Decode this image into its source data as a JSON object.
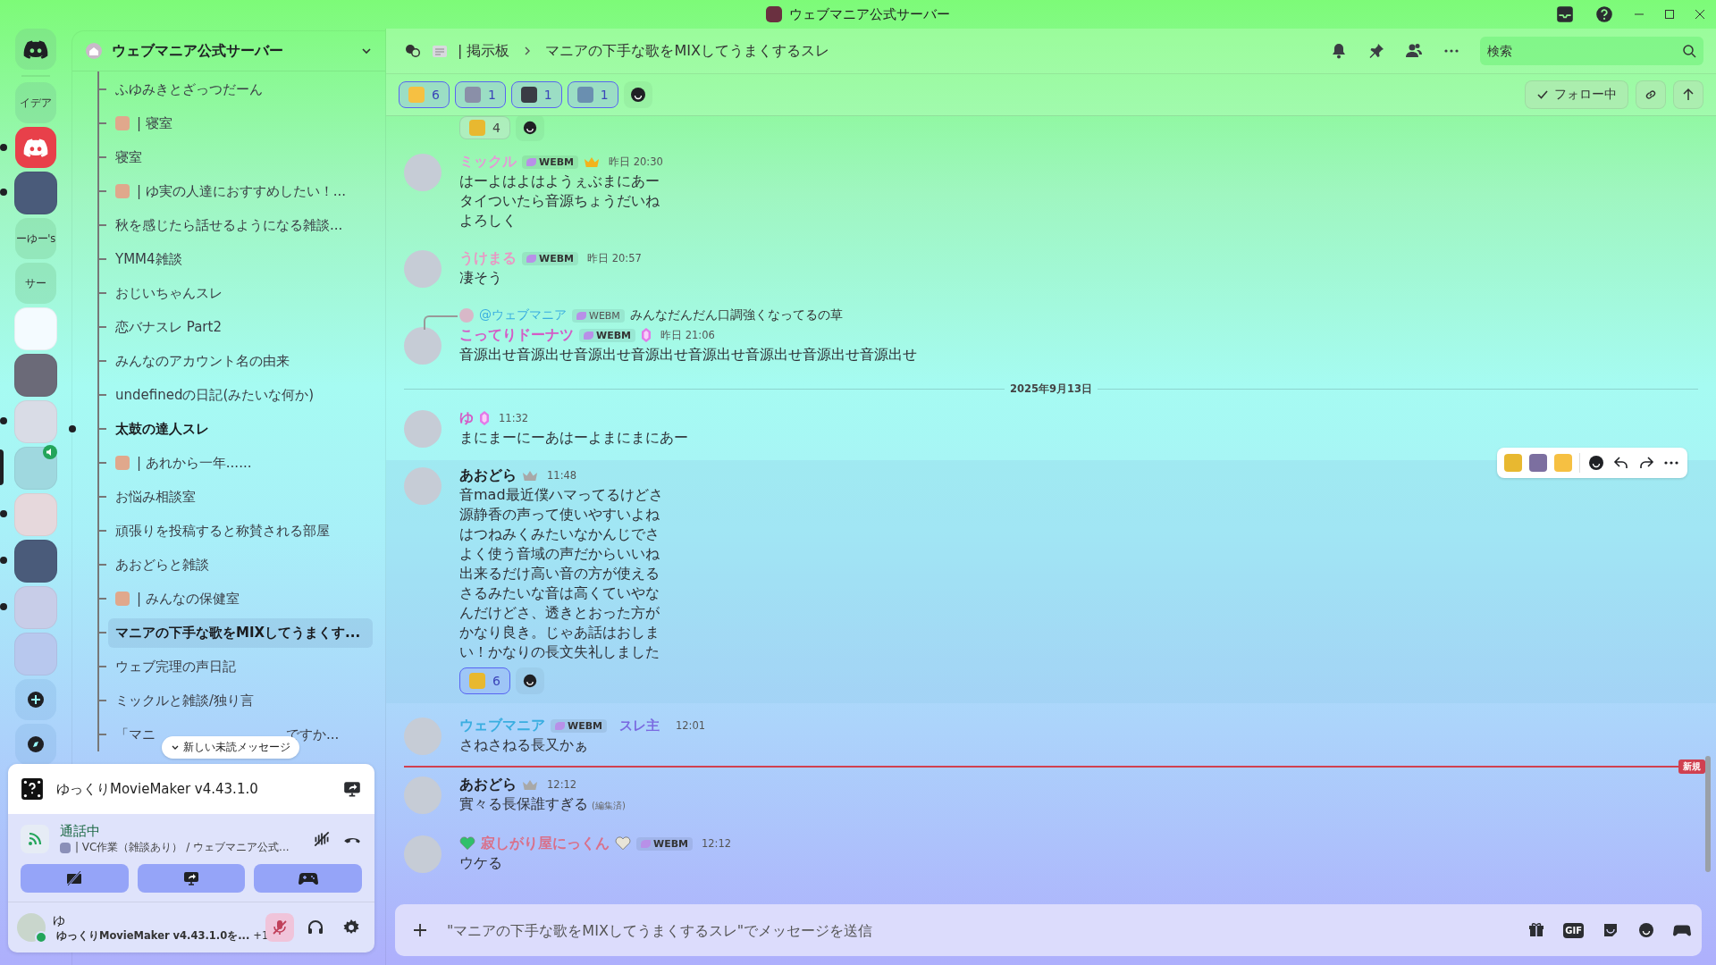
{
  "window": {
    "title": "ウェブマニア公式サーバー"
  },
  "servers": [
    {
      "kind": "home",
      "unread": false,
      "selected": false
    },
    {
      "kind": "text",
      "label": "イデア",
      "unread": false,
      "selected": false
    },
    {
      "kind": "discord",
      "unread": true,
      "selected": false
    },
    {
      "kind": "image",
      "unread": true,
      "selected": false
    },
    {
      "kind": "text",
      "label": "ーゆー's",
      "unread": false,
      "selected": false
    },
    {
      "kind": "text",
      "label": "サー",
      "unread": false,
      "selected": false
    },
    {
      "kind": "image",
      "unread": false,
      "selected": false
    },
    {
      "kind": "image",
      "unread": false,
      "selected": false
    },
    {
      "kind": "image",
      "unread": true,
      "selected": false
    },
    {
      "kind": "image",
      "unread": false,
      "selected": true,
      "speaking": true
    },
    {
      "kind": "image",
      "unread": true,
      "selected": false
    },
    {
      "kind": "image",
      "unread": true,
      "selected": false
    },
    {
      "kind": "image",
      "unread": true,
      "selected": false
    },
    {
      "kind": "image",
      "unread": false,
      "selected": false
    },
    {
      "kind": "add",
      "unread": false,
      "selected": false
    },
    {
      "kind": "discover",
      "unread": false,
      "selected": false
    }
  ],
  "server_header": {
    "name": "ウェブマニア公式サーバー"
  },
  "channels": [
    {
      "name": "ふゆみきとざっつだーん",
      "emoji": false,
      "unread": false,
      "selected": false
    },
    {
      "name": "| 寝室",
      "emoji": true,
      "unread": false,
      "selected": false
    },
    {
      "name": "寝室",
      "emoji": false,
      "unread": false,
      "selected": false
    },
    {
      "name": "| ゆ実の人達におすすめしたい！...",
      "emoji": true,
      "unread": false,
      "selected": false
    },
    {
      "name": "秋を感じたら話せるようになる雑談...",
      "emoji": false,
      "unread": false,
      "selected": false
    },
    {
      "name": "YMM4雑談",
      "emoji": false,
      "unread": false,
      "selected": false
    },
    {
      "name": "おじいちゃんスレ",
      "emoji": false,
      "unread": false,
      "selected": false
    },
    {
      "name": "恋バナスレ Part2",
      "emoji": false,
      "unread": false,
      "selected": false
    },
    {
      "name": "みんなのアカウント名の由来",
      "emoji": false,
      "unread": false,
      "selected": false
    },
    {
      "name": "undefinedの日記(みたいな何か)",
      "emoji": false,
      "unread": false,
      "selected": false
    },
    {
      "name": "太鼓の達人スレ",
      "emoji": false,
      "unread": true,
      "selected": false
    },
    {
      "name": "| あれから一年......",
      "emoji": true,
      "unread": false,
      "selected": false
    },
    {
      "name": "お悩み相談室",
      "emoji": false,
      "unread": false,
      "selected": false
    },
    {
      "name": "頑張りを投稿すると称賛される部屋",
      "emoji": false,
      "unread": false,
      "selected": false
    },
    {
      "name": "あおどらと雑談",
      "emoji": false,
      "unread": false,
      "selected": false
    },
    {
      "name": "| みんなの保健室",
      "emoji": true,
      "unread": false,
      "selected": false
    },
    {
      "name": "マニアの下手な歌をMIXしてうまくす...",
      "emoji": false,
      "unread": true,
      "selected": true
    },
    {
      "name": "ウェブ完理の声日記",
      "emoji": false,
      "unread": false,
      "selected": false
    },
    {
      "name": "ミックルと雑談/独り言",
      "emoji": false,
      "unread": false,
      "selected": false
    },
    {
      "name": "「マニ",
      "name_after": "ですか...",
      "emoji": false,
      "unread": false,
      "selected": false
    }
  ],
  "unread_pill": "新しい未読メッセージ",
  "activity": {
    "title": "ゆっくりMovieMaker v4.43.1.0"
  },
  "voice": {
    "status": "通話中",
    "channel": "| VC作業（雑談あり） / ウェブマニア公式..."
  },
  "user": {
    "name": "ゆ",
    "activity": "ゆっくりMovieMaker v4.43.1.0を...",
    "extra": "+1",
    "muted": true
  },
  "header": {
    "forum": "| 掲示板",
    "thread": "マニアの下手な歌をMIXしてうまくするスレ",
    "search": {
      "placeholder": "検索"
    }
  },
  "thread_reactions": [
    {
      "count": "6",
      "selected": true
    },
    {
      "count": "1",
      "selected": true
    },
    {
      "count": "1",
      "selected": true
    },
    {
      "count": "1",
      "selected": true
    }
  ],
  "follow_button": "フォロー中",
  "messages": [
    {
      "kind": "reactions",
      "reactions": [
        {
          "count": "4",
          "selected": false
        }
      ]
    },
    {
      "kind": "message",
      "author": "ミックル",
      "color": "#e49ad6",
      "tag": "WEBM",
      "badge": {
        "kind": "crown"
      },
      "time": "昨日 20:30",
      "lines": [
        "はーよはよはようぇぶまにあー",
        "タイついたら音源ちょうだいね",
        "よろしく"
      ]
    },
    {
      "kind": "message",
      "author": "うけまる",
      "color": "#e79ac4",
      "tag": "WEBM",
      "time": "昨日 20:57",
      "lines": [
        "凄そう"
      ]
    },
    {
      "kind": "message",
      "author": "こってりドーナツ",
      "color": "#d45cc6",
      "tag": "WEBM",
      "badge": {
        "kind": "gem"
      },
      "time": "昨日 21:06",
      "reply": {
        "author": "@ウェブマニア",
        "color": "#3aaee0",
        "tag": "WEBM",
        "text": "みんなだんだん口調強くなってるの草"
      },
      "lines": [
        "音源出せ音源出せ音源出せ音源出せ音源出せ音源出せ音源出せ音源出せ"
      ]
    },
    {
      "kind": "date",
      "text": "2025年9月13日"
    },
    {
      "kind": "message",
      "author": "ゆ",
      "color": "#d45cc6",
      "badge": {
        "kind": "gem"
      },
      "time": "11:32",
      "lines": [
        "まにまーにーあはーよまにまにあー"
      ]
    },
    {
      "kind": "message",
      "author": "あおどら",
      "color": "#1f2024",
      "badge": {
        "kind": "crown-gray"
      },
      "time": "11:48",
      "hovered": true,
      "lines": [
        "音mad最近僕ハマってるけどさ",
        "源静香の声って使いやすいよね",
        "はつねみくみたいなかんじでさ",
        "よく使う音域の声だからいいね",
        "出来るだけ高い音の方が使える",
        "さるみたいな音は高くていやな",
        "んだけどさ、透きとおった方が",
        "かなり良き。じゃあ話はおしま",
        "い！かなりの長文失礼しました"
      ],
      "reactions": [
        {
          "count": "6",
          "selected": true
        }
      ]
    },
    {
      "kind": "message",
      "author": "ウェブマニア",
      "color": "#3aaee0",
      "tag": "WEBM",
      "role": "スレ主",
      "time": "12:01",
      "lines": [
        "さねさねる長又かぁ"
      ]
    },
    {
      "kind": "new",
      "text": "新規"
    },
    {
      "kind": "message",
      "author": "あおどら",
      "color": "#1f2024",
      "badge": {
        "kind": "crown-gray"
      },
      "time": "12:12",
      "lines": [
        "實々る長保誰すぎる"
      ],
      "edited": "(編集済)"
    },
    {
      "kind": "message",
      "author": "寂しがり屋にっくん",
      "color": "#d9708a",
      "prefix_badge": {
        "kind": "heart"
      },
      "badge": {
        "kind": "heart-outline"
      },
      "tag": "WEBM",
      "time": "12:12",
      "lines": [
        "ウケる"
      ]
    }
  ],
  "composer": {
    "placeholder": "\"マニアの下手な歌をMIXしてうまくするスレ\"でメッセージを送信",
    "gif": "GIF"
  }
}
